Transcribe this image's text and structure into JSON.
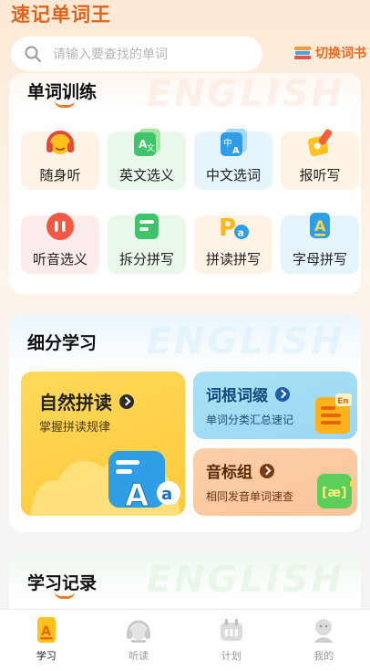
{
  "app": {
    "title": "速记单词王"
  },
  "search": {
    "placeholder": "请输入要查找的单词"
  },
  "switch_book": {
    "label": "切换词书"
  },
  "training": {
    "title": "单词训练",
    "watermark": "ENGLISH",
    "items": [
      {
        "label": "随身听",
        "icon": "headphones-icon"
      },
      {
        "label": "英文选义",
        "icon": "translate-en-icon"
      },
      {
        "label": "中文选词",
        "icon": "translate-zh-icon"
      },
      {
        "label": "报听写",
        "icon": "dictation-icon"
      },
      {
        "label": "听音选义",
        "icon": "audio-wave-icon"
      },
      {
        "label": "拆分拼写",
        "icon": "split-spell-icon"
      },
      {
        "label": "拼读拼写",
        "icon": "phonics-spell-icon"
      },
      {
        "label": "字母拼写",
        "icon": "letter-spell-icon"
      }
    ]
  },
  "subdivided": {
    "title": "细分学习",
    "watermark": "ENGLISH",
    "phonics": {
      "title": "自然拼读",
      "subtitle": "掌握拼读规律"
    },
    "roots": {
      "title": "词根词缀",
      "subtitle": "单词分类汇总速记"
    },
    "phonetic": {
      "title": "音标组",
      "subtitle": "相同发音单词速查"
    }
  },
  "records": {
    "title": "学习记录",
    "watermark": "ENGLISH"
  },
  "tabbar": {
    "items": [
      {
        "label": "学习",
        "icon": "study-icon",
        "active": true
      },
      {
        "label": "听读",
        "icon": "listen-icon",
        "active": false
      },
      {
        "label": "计划",
        "icon": "plan-icon",
        "active": false
      },
      {
        "label": "我的",
        "icon": "profile-icon",
        "active": false
      }
    ]
  },
  "colors": {
    "accent": "#ea6a1f",
    "title": "#e0641e"
  }
}
